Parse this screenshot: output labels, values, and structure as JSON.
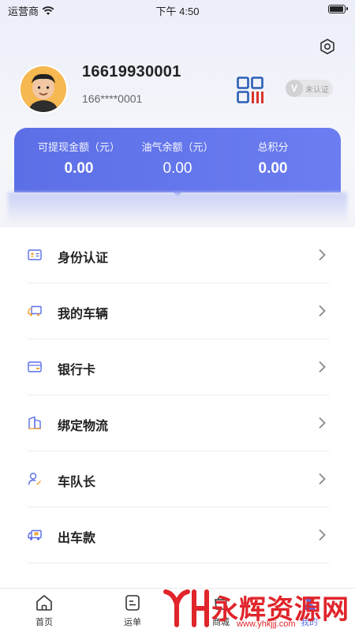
{
  "status_bar": {
    "carrier": "运营商",
    "time": "下午 4:50"
  },
  "profile": {
    "phone": "16619930001",
    "masked_phone": "166****0001",
    "verify_label": "未认证",
    "verify_mark": "V"
  },
  "stats": [
    {
      "label": "可提现金额（元）",
      "value": "0.00"
    },
    {
      "label": "油气余额（元）",
      "value": "0.00"
    },
    {
      "label": "总积分",
      "value": "0.00"
    }
  ],
  "menu": [
    {
      "label": "身份认证",
      "icon": "id-card-icon"
    },
    {
      "label": "我的车辆",
      "icon": "truck-icon"
    },
    {
      "label": "银行卡",
      "icon": "bank-card-icon"
    },
    {
      "label": "绑定物流",
      "icon": "building-icon"
    },
    {
      "label": "车队长",
      "icon": "captain-icon"
    },
    {
      "label": "出车款",
      "icon": "truck-payment-icon"
    }
  ],
  "tabs": [
    {
      "label": "首页",
      "icon": "home-icon"
    },
    {
      "label": "运单",
      "icon": "waybill-icon"
    },
    {
      "label": "商城",
      "icon": "mall-icon"
    },
    {
      "label": "我的",
      "icon": "profile-icon"
    }
  ],
  "watermark": {
    "text": "永辉资源网",
    "url": "www.yhkjjj.com"
  },
  "colors": {
    "accent": "#5c6fe6",
    "watermark": "#e0252b"
  }
}
